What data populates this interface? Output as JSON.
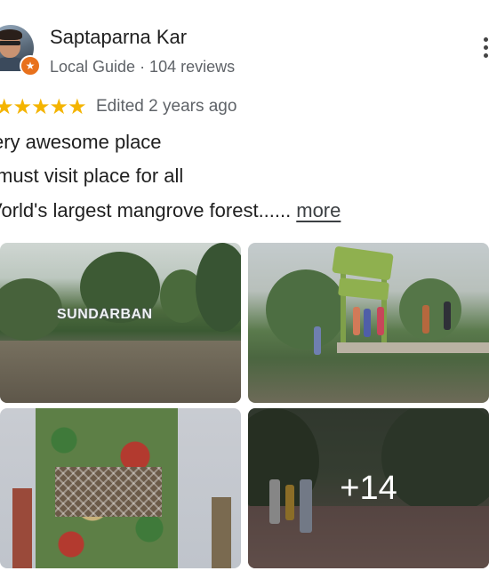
{
  "reviewer": {
    "name": "Saptaparna Kar",
    "meta": "Local Guide · 104 reviews",
    "badge_icon": "local-guide-star-icon"
  },
  "review": {
    "rating": 5,
    "stars_text": "★★★★★",
    "edited": "Edited 2 years ago",
    "lines": [
      "ery awesome place",
      " must visit place for all",
      "Vorld's largest mangrove forest......"
    ],
    "more_label": "more"
  },
  "photos": {
    "sign_text": "SUNDARBAN",
    "more_count": "+14"
  },
  "colors": {
    "star": "#f4b400",
    "badge": "#e8711c",
    "secondary_text": "#5f6368"
  }
}
